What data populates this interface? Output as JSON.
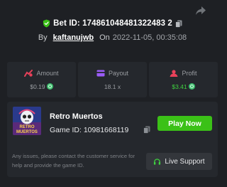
{
  "header": {
    "bet_id": "Bet ID: 174861048481322483 2",
    "by_label": "By",
    "username": "kaftanujwb",
    "on_label": "On",
    "date": "2022-11-05, 00:35:08"
  },
  "stats": [
    {
      "label": "Amount",
      "value": "$0.19",
      "icon": "money-icon"
    },
    {
      "label": "Payout",
      "value": "18.1 x",
      "icon": "card-icon"
    },
    {
      "label": "Profit",
      "value": "$3.41",
      "icon": "profit-icon"
    }
  ],
  "game": {
    "title": "Retro Muertos",
    "id_text": "Game ID: 10981668119",
    "play_label": "Play Now",
    "thumb_text_1": "RETRO",
    "thumb_text_2": "MUERTOS"
  },
  "support": {
    "text": "Any issues, please contact the customer service for help and provide the game ID.",
    "button_label": "Live Support"
  },
  "colors": {
    "accent": "#3bc117",
    "profit": "#3ed23f",
    "background": "#1e2024",
    "card": "#25282d"
  }
}
